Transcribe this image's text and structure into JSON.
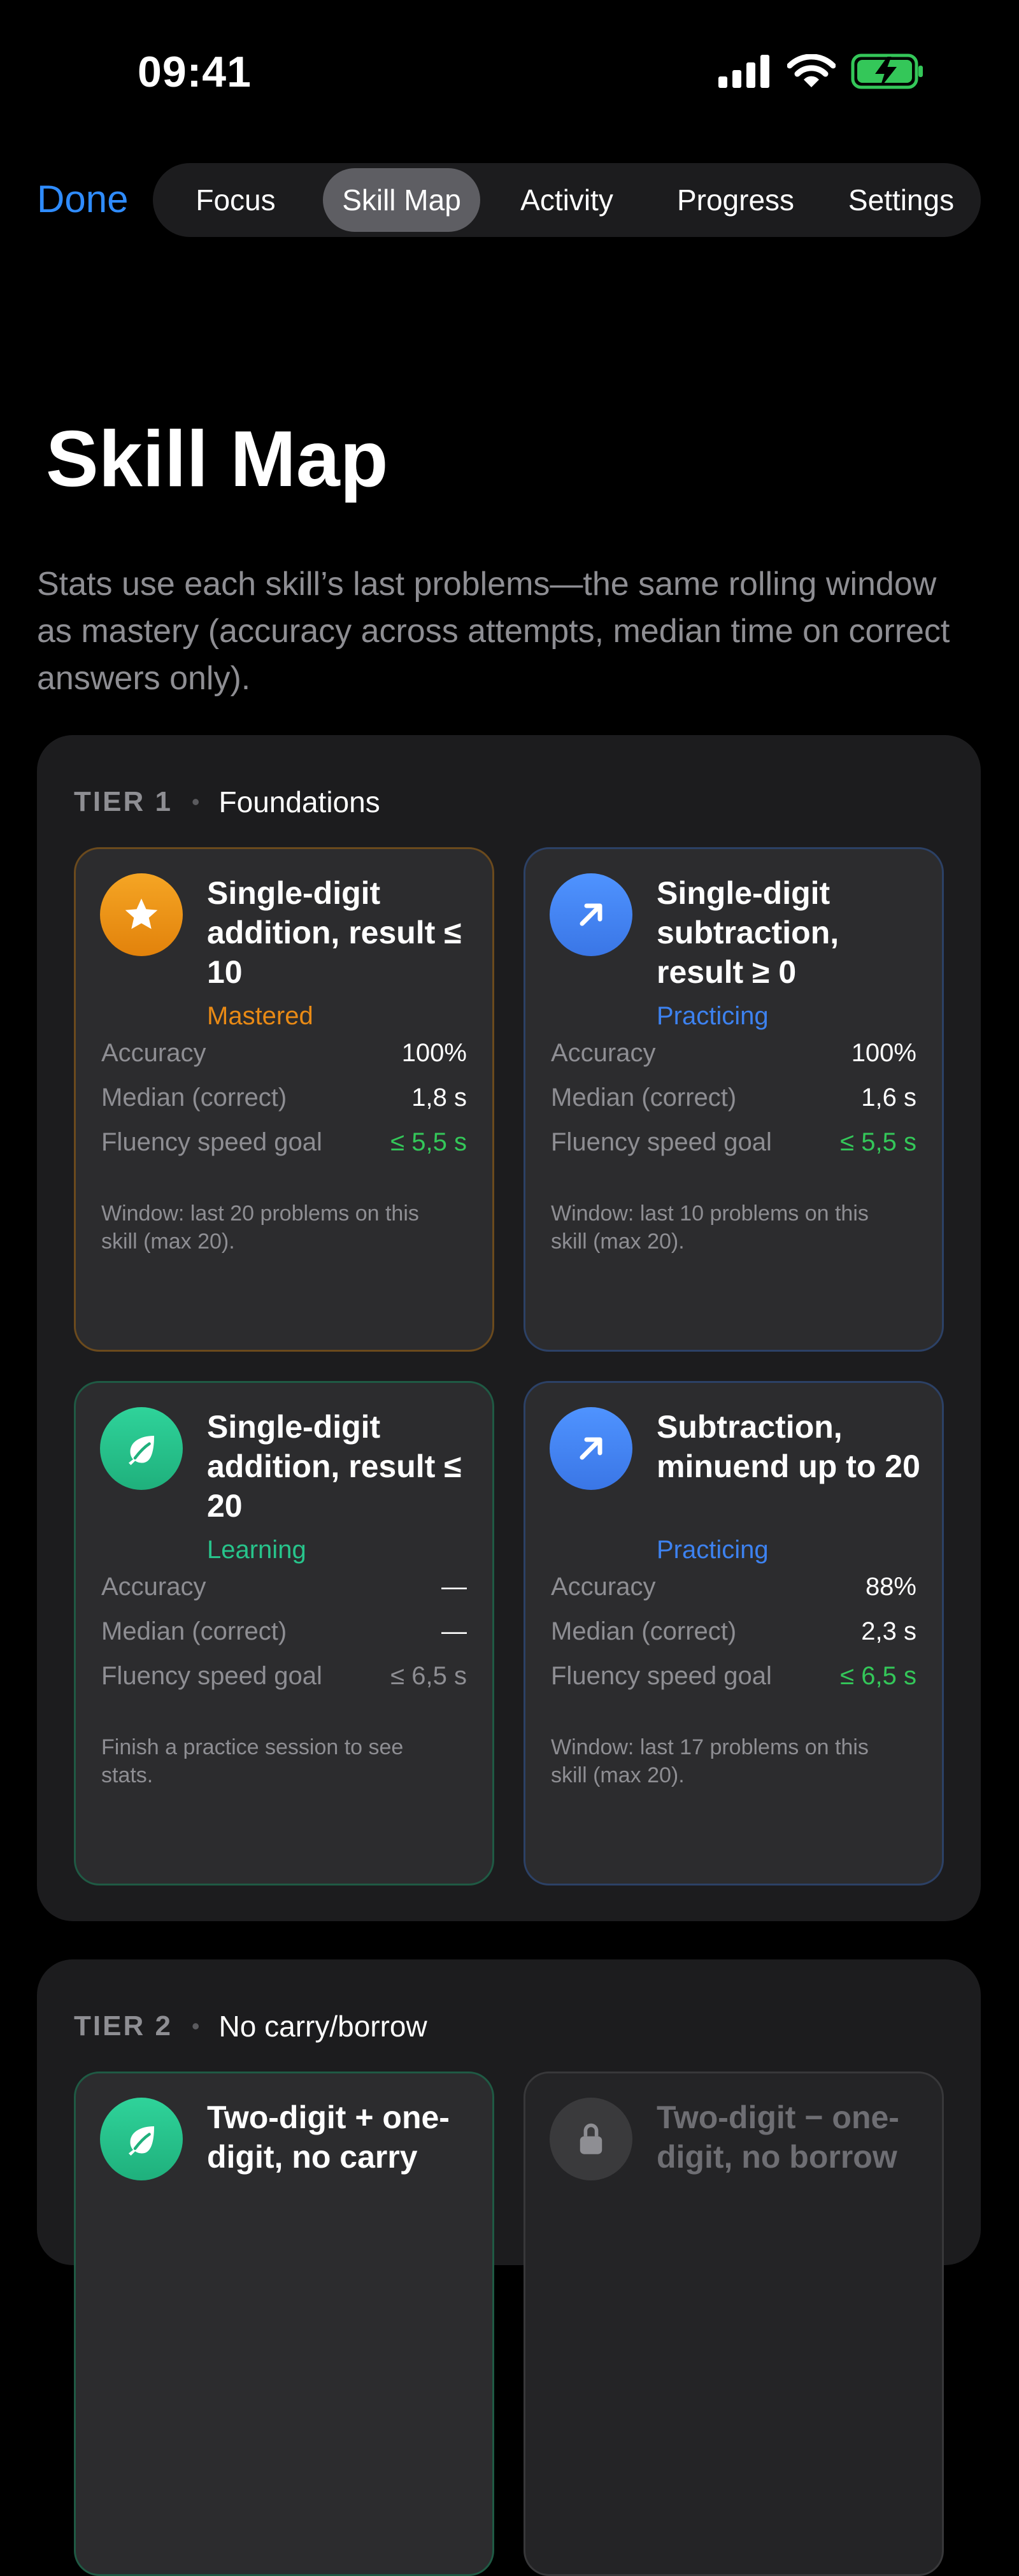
{
  "status_bar": {
    "time": "09:41"
  },
  "nav": {
    "done_label": "Done",
    "tabs": [
      {
        "label": "Focus"
      },
      {
        "label": "Skill Map"
      },
      {
        "label": "Activity"
      },
      {
        "label": "Progress"
      },
      {
        "label": "Settings"
      }
    ],
    "active_tab": "Skill Map"
  },
  "page": {
    "title": "Skill Map",
    "subtitle": "Stats use each skill’s last problems—the same rolling window as mastery (accuracy across attempts, median time on correct answers only)."
  },
  "stat_labels": {
    "accuracy": "Accuracy",
    "median": "Median (correct)",
    "goal": "Fluency speed goal"
  },
  "colors": {
    "mastered": "#e98a15",
    "practicing": "#3d82f0",
    "learning": "#27c48b",
    "goal_met": "#34c759"
  },
  "tiers": [
    {
      "label": "TIER 1",
      "name": "Foundations",
      "skills": [
        {
          "title": "Single-digit addition, result ≤ 10",
          "status": "Mastered",
          "icon": "star-icon",
          "accuracy": "100%",
          "median": "1,8 s",
          "goal": "≤ 5,5 s",
          "note": "Window: last 20 problems on this skill (max 20)."
        },
        {
          "title": "Single-digit subtraction, result ≥ 0",
          "status": "Practicing",
          "icon": "arrow-up-right-icon",
          "accuracy": "100%",
          "median": "1,6 s",
          "goal": "≤ 5,5 s",
          "note": "Window: last 10 problems on this skill (max 20)."
        },
        {
          "title": "Single-digit addition, result ≤ 20",
          "status": "Learning",
          "icon": "leaf-icon",
          "accuracy": "—",
          "median": "—",
          "goal": "≤ 6,5 s",
          "note": "Finish a practice session to see stats."
        },
        {
          "title": "Subtraction, minuend up to 20",
          "status": "Practicing",
          "icon": "arrow-up-right-icon",
          "accuracy": "88%",
          "median": "2,3 s",
          "goal": "≤ 6,5 s",
          "note": "Window: last 17 problems on this skill (max 20)."
        }
      ]
    },
    {
      "label": "TIER 2",
      "name": "No carry/borrow",
      "skills": [
        {
          "title": "Two-digit + one-digit, no carry",
          "icon": "leaf-icon"
        },
        {
          "title": "Two-digit − one-digit, no borrow",
          "icon": "lock-icon"
        }
      ]
    }
  ]
}
